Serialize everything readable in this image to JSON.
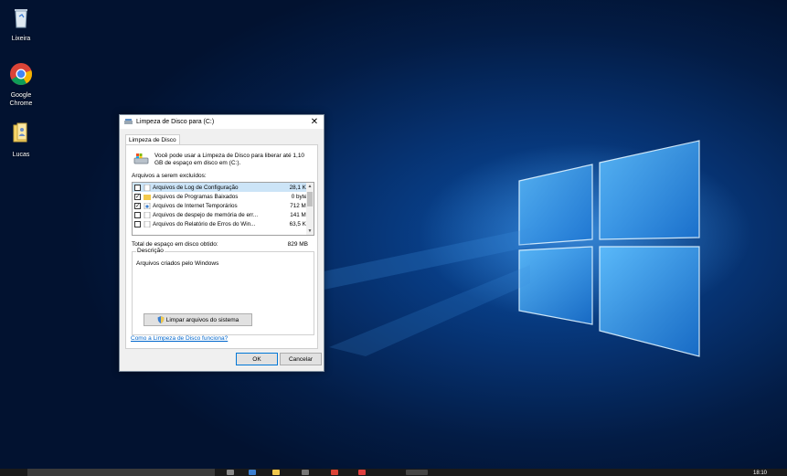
{
  "desktop": {
    "icons": [
      {
        "label": "Lixeira",
        "icon": "recycle-bin-icon"
      },
      {
        "label": "Google Chrome",
        "icon": "chrome-icon"
      },
      {
        "label": "Lucas",
        "icon": "user-folder-icon"
      }
    ]
  },
  "dialog": {
    "title": "Limpeza de Disco para  (C:)",
    "tab_label": "Limpeza de Disco",
    "intro_text": "Você pode usar a Limpeza de Disco para liberar até 1,10 GB de espaço em disco em  (C:).",
    "files_label": "Arquivos a serem excluídos:",
    "files": [
      {
        "name": "Arquivos de Log de Configuração",
        "size": "28,1 KB",
        "checked": false,
        "selected": true
      },
      {
        "name": "Arquivos de Programas Baixados",
        "size": "0 bytes",
        "checked": true,
        "selected": false
      },
      {
        "name": "Arquivos de Internet Temporários",
        "size": "712 MB",
        "checked": true,
        "selected": false
      },
      {
        "name": "Arquivos de despejo de memória de err...",
        "size": "141 MB",
        "checked": false,
        "selected": false
      },
      {
        "name": "Arquivos do Relatório de Erros do Win...",
        "size": "63,5 KB",
        "checked": false,
        "selected": false
      }
    ],
    "total_label": "Total de espaço em disco obtido:",
    "total_value": "829 MB",
    "description_legend": "Descrição",
    "description_text": "Arquivos criados pelo Windows",
    "clean_system_label": "Limpar arquivos do sistema",
    "how_link": "Como a Limpeza de Disco funciona?",
    "ok_label": "OK",
    "cancel_label": "Cancelar",
    "close_glyph": "✕"
  },
  "taskbar": {
    "clock": "18:10"
  },
  "colors": {
    "accent": "#0078d7",
    "link": "#0066cc",
    "selection": "#cce4f7"
  }
}
